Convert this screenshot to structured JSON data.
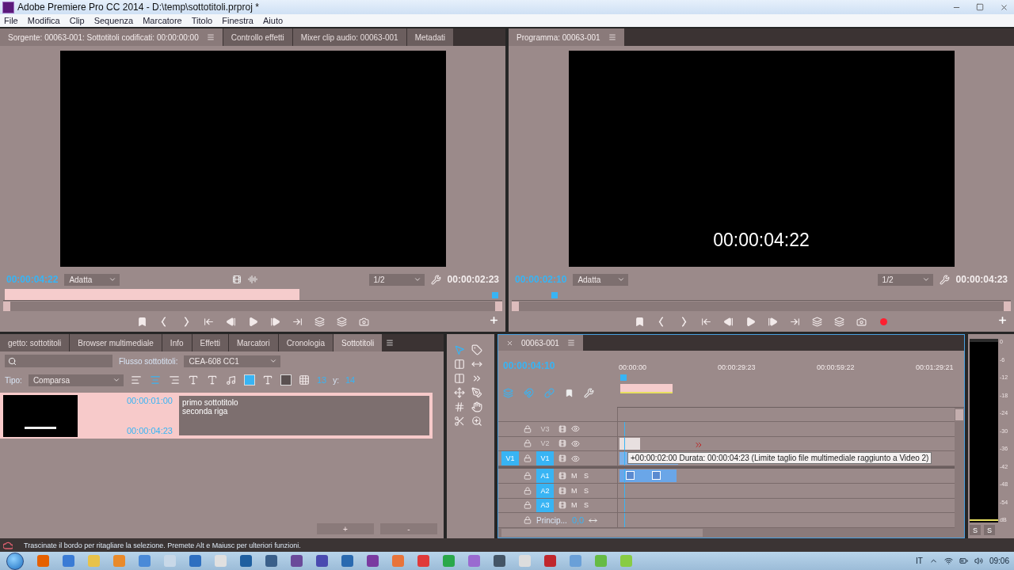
{
  "window": {
    "title": "Adobe Premiere Pro CC 2014 - D:\\temp\\sottotitoli.prproj *"
  },
  "menu": [
    "File",
    "Modifica",
    "Clip",
    "Sequenza",
    "Marcatore",
    "Titolo",
    "Finestra",
    "Aiuto"
  ],
  "source_monitor": {
    "tabs": [
      {
        "label": "Sorgente: 00063-001: Sottotitoli codificati: 00:00:00:00",
        "selected": true
      },
      {
        "label": "Controllo effetti",
        "selected": false
      },
      {
        "label": "Mixer clip audio: 00063-001",
        "selected": false
      },
      {
        "label": "Metadati",
        "selected": false
      }
    ],
    "timecode": "00:00:04:22",
    "fit": "Adatta",
    "resolution": "1/2",
    "duration": "00:00:02:23",
    "transport": [
      {
        "kind": "marker"
      },
      {
        "kind": "mark-in"
      },
      {
        "kind": "mark-out"
      },
      {
        "kind": "go-to-in"
      },
      {
        "kind": "step-back"
      },
      {
        "kind": "play"
      },
      {
        "kind": "step-forward"
      },
      {
        "kind": "go-to-out"
      },
      {
        "kind": "insert"
      },
      {
        "kind": "overwrite"
      },
      {
        "kind": "export-frame"
      }
    ]
  },
  "program_monitor": {
    "tabs": [
      {
        "label": "Programma: 00063-001",
        "selected": true
      }
    ],
    "overlay_timecode": "00:00:04:22",
    "timecode": "00:00:02:10",
    "fit": "Adatta",
    "resolution": "1/2",
    "duration": "00:00:04:23",
    "transport": [
      {
        "kind": "marker"
      },
      {
        "kind": "mark-in"
      },
      {
        "kind": "mark-out"
      },
      {
        "kind": "go-to-in"
      },
      {
        "kind": "step-back"
      },
      {
        "kind": "play"
      },
      {
        "kind": "step-forward"
      },
      {
        "kind": "go-to-out"
      },
      {
        "kind": "lift"
      },
      {
        "kind": "extract"
      },
      {
        "kind": "export-frame"
      },
      {
        "kind": "record"
      }
    ]
  },
  "captions_panel": {
    "tabs": [
      {
        "label": "getto: sottotitoli",
        "selected": false
      },
      {
        "label": "Browser multimediale",
        "selected": false
      },
      {
        "label": "Info",
        "selected": false
      },
      {
        "label": "Effetti",
        "selected": false
      },
      {
        "label": "Marcatori",
        "selected": false
      },
      {
        "label": "Cronologia",
        "selected": false
      },
      {
        "label": "Sottotitoli",
        "selected": true
      }
    ],
    "stream_label": "Flusso sottotitoli:",
    "stream": "CEA-608 CC1",
    "type_label": "Tipo:",
    "type": "Comparsa",
    "alignments": [
      {
        "kind": "left",
        "selected": false
      },
      {
        "kind": "center",
        "selected": true
      },
      {
        "kind": "right",
        "selected": false
      }
    ],
    "x_value": "13",
    "y_label": "y:",
    "y_value": "14",
    "captions": [
      {
        "start": "00:00:01:00",
        "end": "00:00:04:23",
        "text": "primo sottotitolo\nseconda riga",
        "selected": true
      }
    ],
    "buttons": [
      "+",
      "-"
    ]
  },
  "tools": [
    {
      "kind": "select",
      "selected": true
    },
    {
      "kind": "track-select",
      "selected": false
    },
    {
      "kind": "ripple",
      "selected": false
    },
    {
      "kind": "rolling",
      "selected": false
    },
    {
      "kind": "rate",
      "selected": false
    },
    {
      "kind": "razor",
      "selected": false
    },
    {
      "kind": "slip",
      "selected": false
    },
    {
      "kind": "pen",
      "selected": false
    },
    {
      "kind": "slide",
      "selected": false
    },
    {
      "kind": "hand",
      "selected": false
    },
    {
      "kind": "stretch",
      "selected": false
    },
    {
      "kind": "zoom",
      "selected": false
    }
  ],
  "timeline": {
    "tab": "00063-001",
    "timecode": "00:00:04:10",
    "ruler": [
      "00:00:00",
      "00:00:29:23",
      "00:00:59:22",
      "00:01:29:21"
    ],
    "tracks": [
      {
        "kind": "video",
        "name": "V3",
        "targeted": false
      },
      {
        "kind": "video",
        "name": "V2",
        "targeted": false
      },
      {
        "kind": "video",
        "name": "V1",
        "targeted": true,
        "source": "V1"
      },
      {
        "kind": "audio",
        "name": "A1",
        "targeted": true,
        "mute": "M",
        "solo": "S"
      },
      {
        "kind": "audio",
        "name": "A2",
        "targeted": true,
        "mute": "M",
        "solo": "S"
      },
      {
        "kind": "audio",
        "name": "A3",
        "targeted": true,
        "mute": "M",
        "solo": "S"
      },
      {
        "kind": "master",
        "name": "Princip...",
        "value": "0,0"
      }
    ],
    "tooltip": "+00:00:02:00 Durata: 00:00:04:23 (Limite taglio file multimediale raggiunto a Video 2)"
  },
  "audio_meter": {
    "scale": [
      "0",
      "-6",
      "-12",
      "-18",
      "-24",
      "-30",
      "-36",
      "-42",
      "-48",
      "-54",
      "dB"
    ],
    "buttons": [
      "S",
      "S"
    ]
  },
  "status_bar": "Trascinate il bordo per ritagliare la selezione. Premete Alt e Maiusc per ulteriori funzioni.",
  "taskbar": {
    "apps": [
      {
        "color": "#e66000"
      },
      {
        "color": "#3a7bd5"
      },
      {
        "color": "#e8c24a"
      },
      {
        "color": "#e98a2b"
      },
      {
        "color": "#4a8ad8"
      },
      {
        "color": "#c8d8e8"
      },
      {
        "color": "#2f6fc0"
      },
      {
        "color": "#e0e0e0"
      },
      {
        "color": "#1f5fa0"
      },
      {
        "color": "#3a5f8a"
      },
      {
        "color": "#6a4a9a"
      },
      {
        "color": "#4a4ab0"
      },
      {
        "color": "#2a6ab0"
      },
      {
        "color": "#7a3aa0"
      },
      {
        "color": "#e8743a"
      },
      {
        "color": "#e03a3a"
      },
      {
        "color": "#2aa84a"
      },
      {
        "color": "#9a6ad0"
      },
      {
        "color": "#445566"
      },
      {
        "color": "#dddddd"
      },
      {
        "color": "#c0272d"
      },
      {
        "color": "#6aa0d8"
      },
      {
        "color": "#66bb44"
      },
      {
        "color": "#88cc44"
      }
    ],
    "language": "IT",
    "clock": "09:06"
  }
}
